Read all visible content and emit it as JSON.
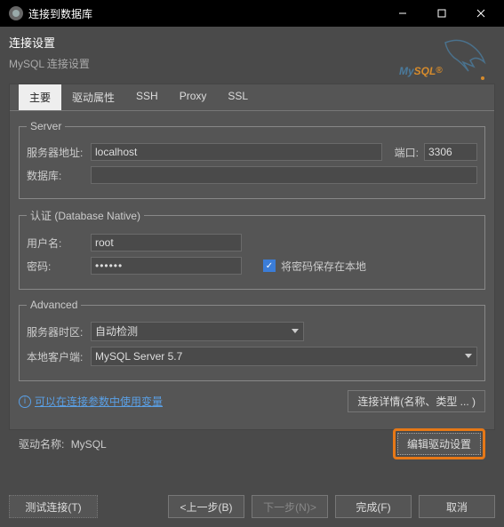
{
  "window": {
    "title": "连接到数据库"
  },
  "header": {
    "title": "连接设置",
    "subtitle": "MySQL 连接设置",
    "brand_my": "My",
    "brand_sql": "SQL",
    "brand_reg": "®"
  },
  "tabs": {
    "main": "主要",
    "driver": "驱动属性",
    "ssh": "SSH",
    "proxy": "Proxy",
    "ssl": "SSL"
  },
  "server": {
    "legend": "Server",
    "host_label": "服务器地址:",
    "host_value": "localhost",
    "port_label": "端口:",
    "port_value": "3306",
    "database_label": "数据库:",
    "database_value": ""
  },
  "auth": {
    "legend": "认证 (Database Native)",
    "user_label": "用户名:",
    "user_value": "root",
    "password_label": "密码:",
    "password_value": "••••••",
    "save_password_label": "将密码保存在本地"
  },
  "advanced": {
    "legend": "Advanced",
    "timezone_label": "服务器时区:",
    "timezone_value": "自动检测",
    "client_label": "本地客户端:",
    "client_value": "MySQL Server 5.7"
  },
  "info": {
    "vars_link": "可以在连接参数中使用变量",
    "details_button": "连接详情(名称、类型 ... )"
  },
  "driver": {
    "name_label": "驱动名称:",
    "name_value": "MySQL",
    "edit_button": "编辑驱动设置"
  },
  "footer": {
    "test": "测试连接(T)",
    "back": "<上一步(B)",
    "next": "下一步(N)>",
    "finish": "完成(F)",
    "cancel": "取消"
  }
}
